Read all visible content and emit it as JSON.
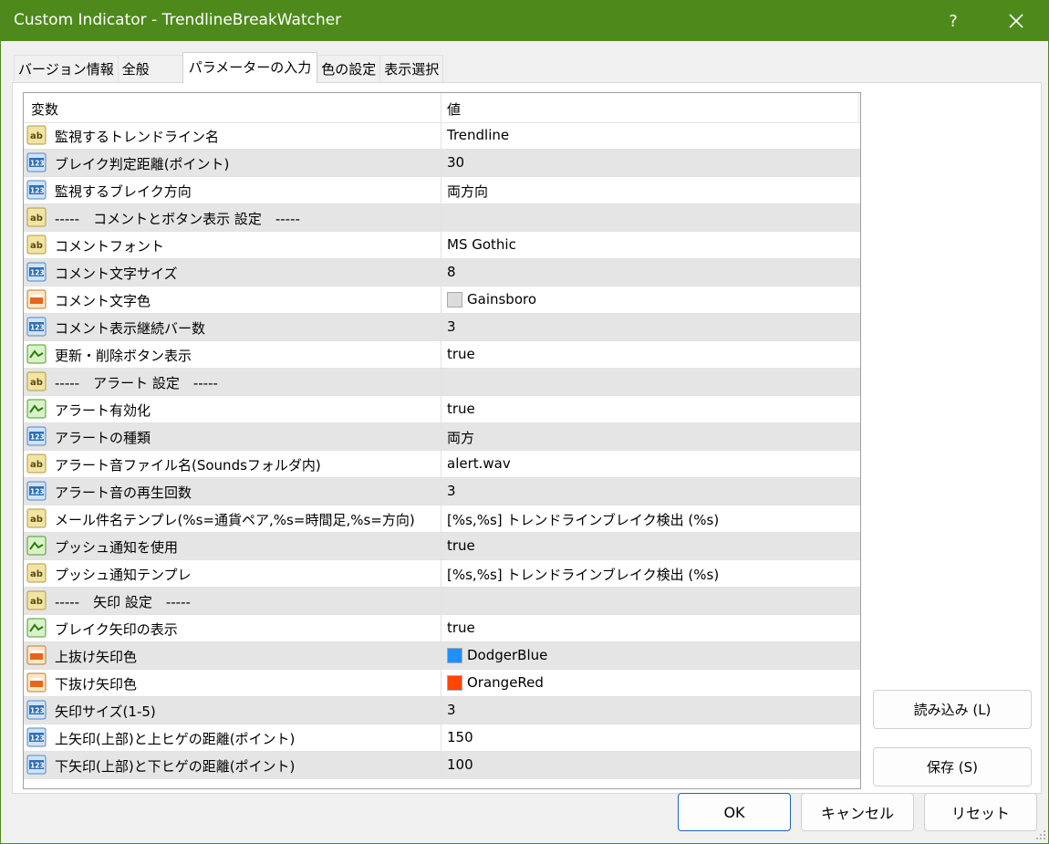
{
  "window": {
    "title": "Custom Indicator - TrendlineBreakWatcher",
    "help": "?"
  },
  "tabs": [
    "バージョン情報",
    "全般",
    "パラメーターの入力",
    "色の設定",
    "表示選択"
  ],
  "grid": {
    "col_variable": "変数",
    "col_value": "値",
    "rows": [
      {
        "icon": "ab",
        "name": "監視するトレンドライン名",
        "value": "Trendline"
      },
      {
        "icon": "123",
        "name": "ブレイク判定距離(ポイント)",
        "value": "30"
      },
      {
        "icon": "123",
        "name": "監視するブレイク方向",
        "value": "両方向"
      },
      {
        "icon": "ab",
        "name": "-----　コメントとボタン表示 設定　-----",
        "value": ""
      },
      {
        "icon": "ab",
        "name": "コメントフォント",
        "value": "MS Gothic"
      },
      {
        "icon": "123",
        "name": "コメント文字サイズ",
        "value": "8"
      },
      {
        "icon": "color",
        "name": "コメント文字色",
        "value": "Gainsboro",
        "swatch": "#dcdcdc"
      },
      {
        "icon": "123",
        "name": "コメント表示継続バー数",
        "value": "3"
      },
      {
        "icon": "bool",
        "name": "更新・削除ボタン表示",
        "value": "true"
      },
      {
        "icon": "ab",
        "name": "-----　アラート 設定　-----",
        "value": ""
      },
      {
        "icon": "bool",
        "name": "アラート有効化",
        "value": "true"
      },
      {
        "icon": "123",
        "name": "アラートの種類",
        "value": "両方"
      },
      {
        "icon": "ab",
        "name": "アラート音ファイル名(Soundsフォルダ内)",
        "value": "alert.wav"
      },
      {
        "icon": "123",
        "name": "アラート音の再生回数",
        "value": "3"
      },
      {
        "icon": "ab",
        "name": "メール件名テンプレ(%s=通貨ペア,%s=時間足,%s=方向)",
        "value": "[%s,%s] トレンドラインブレイク検出 (%s)"
      },
      {
        "icon": "bool",
        "name": "プッシュ通知を使用",
        "value": "true"
      },
      {
        "icon": "ab",
        "name": "プッシュ通知テンプレ",
        "value": "[%s,%s] トレンドラインブレイク検出 (%s)"
      },
      {
        "icon": "ab",
        "name": "-----　矢印 設定　-----",
        "value": ""
      },
      {
        "icon": "bool",
        "name": "ブレイク矢印の表示",
        "value": "true"
      },
      {
        "icon": "color",
        "name": "上抜け矢印色",
        "value": "DodgerBlue",
        "swatch": "#1e90ff"
      },
      {
        "icon": "color",
        "name": "下抜け矢印色",
        "value": "OrangeRed",
        "swatch": "#ff4500"
      },
      {
        "icon": "123",
        "name": "矢印サイズ(1-5)",
        "value": "3"
      },
      {
        "icon": "123",
        "name": "上矢印(上部)と上ヒゲの距離(ポイント)",
        "value": "150"
      },
      {
        "icon": "123",
        "name": "下矢印(上部)と下ヒゲの距離(ポイント)",
        "value": "100"
      }
    ]
  },
  "side_buttons": {
    "load": "読み込み (L)",
    "save": "保存 (S)"
  },
  "bottom_buttons": {
    "ok": "OK",
    "cancel": "キャンセル",
    "reset": "リセット"
  },
  "colors": {
    "titlebar": "#4e8a1b",
    "ok_border": "#1d65b4"
  }
}
